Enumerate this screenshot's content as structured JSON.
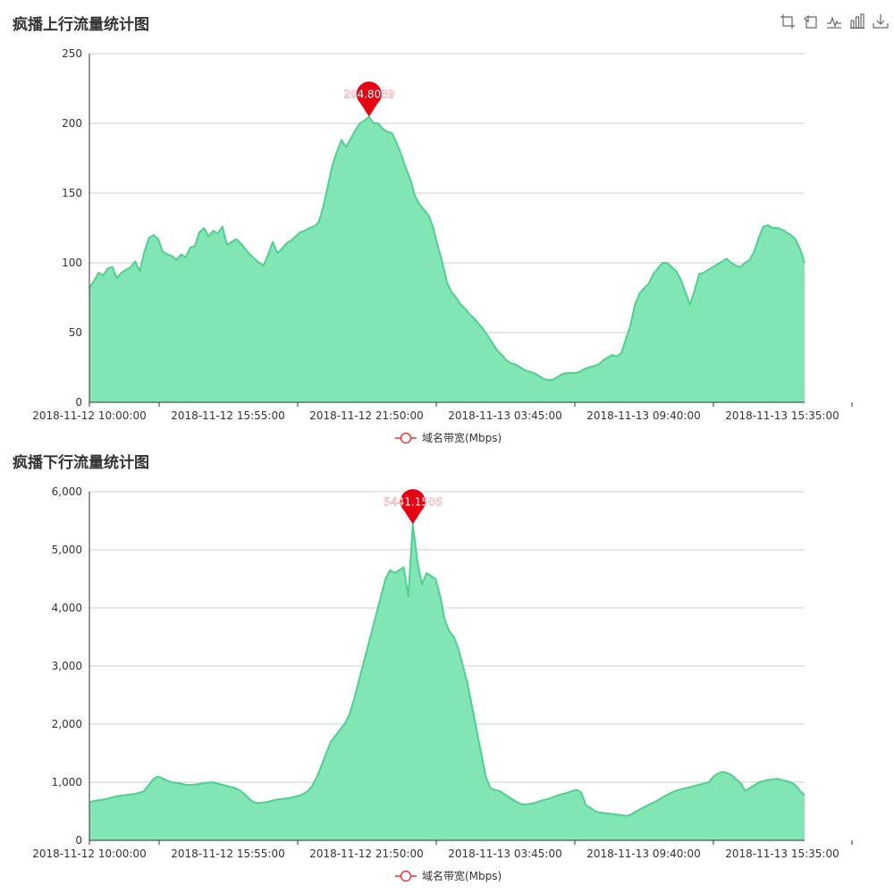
{
  "toolbox": {
    "icons": [
      "zoom-icon",
      "zoom-reset-icon",
      "line-chart-icon",
      "bar-chart-icon",
      "download-icon"
    ]
  },
  "colors": {
    "area_fill": "#82e5b4",
    "area_line": "#4fd08f",
    "marker": "#e60012",
    "legend": "#e4393c",
    "grid": "#cccccc",
    "axis": "#333333"
  },
  "chart_data": [
    {
      "type": "area",
      "title": "疯播上行流量统计图",
      "xlabel": "",
      "ylabel": "",
      "ylim": [
        0,
        250
      ],
      "yticks": [
        "0",
        "50",
        "100",
        "150",
        "200",
        "250"
      ],
      "xticks": [
        "2018-11-12 10:00:00",
        "2018-11-12 15:55:00",
        "2018-11-12 21:50:00",
        "2018-11-13 03:45:00",
        "2018-11-13 09:40:00",
        "2018-11-13 15:35:00"
      ],
      "grid": true,
      "legend": "bottom-center",
      "series": [
        {
          "name": "域名带宽(Mbps)",
          "values": [
            82,
            87,
            93,
            91,
            96,
            97,
            89,
            93,
            95,
            97,
            101,
            94,
            108,
            118,
            120,
            117,
            108,
            106,
            105,
            102,
            106,
            104,
            111,
            112,
            122,
            125,
            119,
            123,
            121,
            126,
            113,
            115,
            117,
            114,
            110,
            106,
            103,
            100,
            98,
            106,
            115,
            107,
            110,
            114,
            116,
            119,
            122,
            123,
            125,
            126,
            129,
            140,
            155,
            170,
            180,
            188,
            183,
            189,
            195,
            200,
            202,
            204.8039,
            200,
            200,
            196,
            194,
            193,
            186,
            178,
            168,
            160,
            148,
            142,
            138,
            134,
            125,
            112,
            100,
            86,
            79,
            75,
            70,
            67,
            63,
            60,
            56,
            52,
            47,
            42,
            37,
            34,
            30,
            28,
            27,
            25,
            23,
            22,
            21,
            19,
            17,
            16,
            16,
            18,
            20,
            21,
            21,
            21,
            22,
            24,
            25,
            26,
            27,
            30,
            32,
            34,
            33,
            35,
            45,
            55,
            70,
            78,
            82,
            85,
            92,
            96,
            100,
            100,
            97,
            94,
            88,
            79,
            70,
            80,
            92,
            93,
            95,
            97,
            99,
            101,
            103,
            100,
            98,
            97,
            100,
            102,
            108,
            118,
            126,
            127,
            125,
            125,
            124,
            122,
            120,
            117,
            110,
            100
          ]
        }
      ],
      "mark_point": {
        "label": "204.8039",
        "value": 204.8039
      }
    },
    {
      "type": "area",
      "title": "疯播下行流量统计图",
      "xlabel": "",
      "ylabel": "",
      "ylim": [
        0,
        6000
      ],
      "yticks": [
        "0",
        "1,000",
        "2,000",
        "3,000",
        "4,000",
        "5,000",
        "6,000"
      ],
      "xticks": [
        "2018-11-12 10:00:00",
        "2018-11-12 15:55:00",
        "2018-11-12 21:50:00",
        "2018-11-13 03:45:00",
        "2018-11-13 09:40:00",
        "2018-11-13 15:35:00"
      ],
      "grid": true,
      "legend": "bottom-center",
      "series": [
        {
          "name": "域名带宽(Mbps)",
          "values": [
            650,
            680,
            690,
            700,
            720,
            740,
            760,
            770,
            780,
            790,
            800,
            820,
            850,
            950,
            1050,
            1100,
            1070,
            1030,
            1000,
            990,
            980,
            960,
            950,
            960,
            970,
            980,
            990,
            1000,
            980,
            960,
            940,
            920,
            900,
            860,
            800,
            720,
            660,
            640,
            650,
            660,
            680,
            700,
            710,
            720,
            730,
            750,
            770,
            800,
            850,
            950,
            1100,
            1300,
            1500,
            1700,
            1800,
            1900,
            2000,
            2150,
            2400,
            2700,
            3000,
            3300,
            3600,
            3900,
            4200,
            4500,
            4650,
            4600,
            4650,
            4700,
            4200,
            5441.1506,
            4800,
            4400,
            4600,
            4550,
            4500,
            4200,
            3800,
            3600,
            3500,
            3300,
            3000,
            2700,
            2300,
            1900,
            1500,
            1100,
            900,
            870,
            850,
            800,
            750,
            700,
            650,
            620,
            620,
            630,
            650,
            680,
            700,
            720,
            750,
            780,
            800,
            820,
            850,
            870,
            820,
            600,
            560,
            500,
            480,
            470,
            460,
            450,
            440,
            430,
            420,
            450,
            500,
            540,
            580,
            620,
            660,
            700,
            750,
            790,
            830,
            860,
            880,
            900,
            920,
            940,
            960,
            980,
            1000,
            1100,
            1150,
            1180,
            1160,
            1120,
            1050,
            980,
            850,
            900,
            950,
            1000,
            1020,
            1040,
            1050,
            1060,
            1040,
            1020,
            1000,
            950,
            850,
            780
          ]
        }
      ],
      "mark_point": {
        "label": "5441.1506",
        "value": 5441.1506
      }
    }
  ]
}
